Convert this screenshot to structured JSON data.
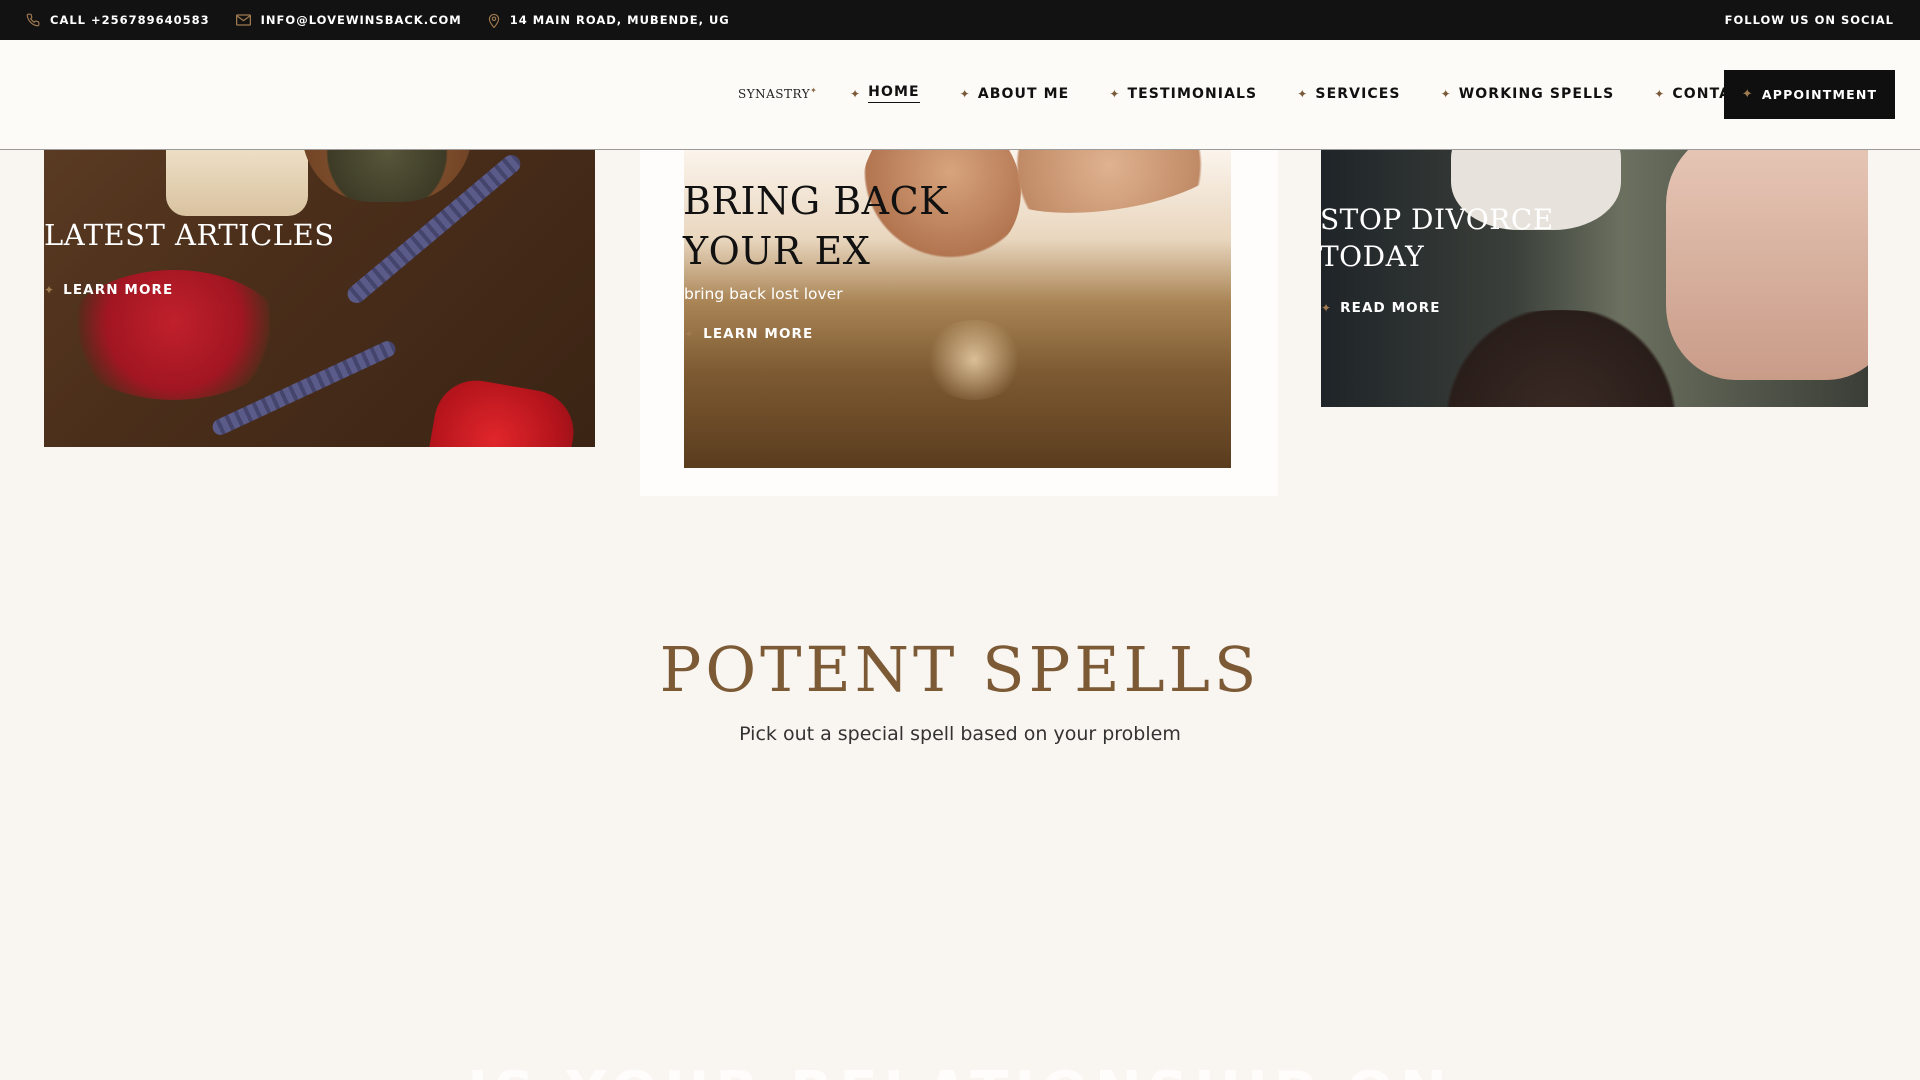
{
  "topbar": {
    "phone": "CALL +256789640583",
    "email": "INFO@LOVEWINSBACK.COM",
    "address": "14 MAIN ROAD, MUBENDE, UG",
    "social": "FOLLOW US ON SOCIAL"
  },
  "header": {
    "logo": "SYNASTRY",
    "nav": [
      {
        "label": "HOME",
        "active": true
      },
      {
        "label": "ABOUT ME"
      },
      {
        "label": "TESTIMONIALS"
      },
      {
        "label": "SERVICES"
      },
      {
        "label": "WORKING SPELLS"
      },
      {
        "label": "CONTACT US"
      }
    ],
    "cta": "APPOINTMENT"
  },
  "cards": [
    {
      "title": "LATEST ARTICLES",
      "link": "LEARN MORE"
    },
    {
      "title_line1": "BRING BACK",
      "title_line2": "YOUR EX",
      "subtitle": "bring back lost lover",
      "link": "LEARN MORE"
    },
    {
      "title_line1": "STOP DIVORCE",
      "title_line2": "TODAY",
      "link": "READ MORE"
    }
  ],
  "section": {
    "title": "POTENT SPELLS",
    "subtitle": "Pick out a special spell based on your problem",
    "next_heading": "IS YOUR RELATIONSHIP ON"
  },
  "icons": {
    "phone": "phone-icon",
    "email": "mail-icon",
    "location": "map-pin-icon",
    "spark": "sparkle-icon"
  },
  "colors": {
    "accent": "#7b5a35",
    "topbar_bg": "#121212",
    "page_bg": "#f9f5f0"
  }
}
